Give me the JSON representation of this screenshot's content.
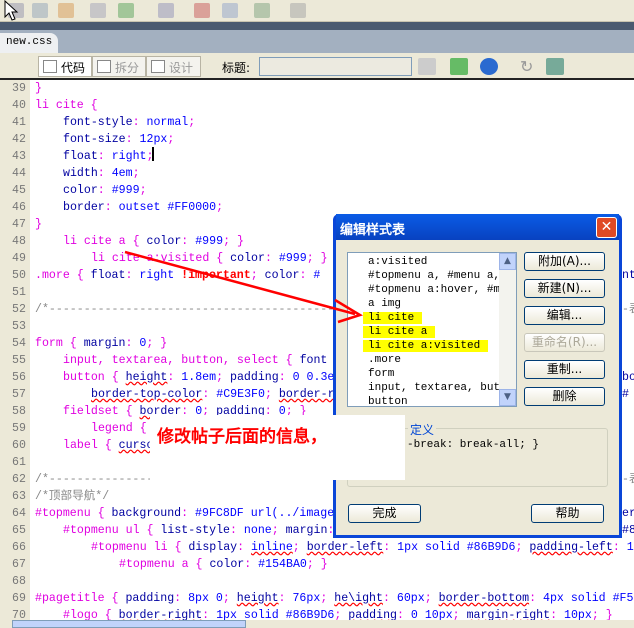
{
  "file_tab": "new.css",
  "view_buttons": {
    "code": "代码",
    "split": "拆分",
    "design": "设计"
  },
  "title_label": "标题:",
  "title_value": "",
  "code_lines": [
    {
      "n": "39",
      "ind": 0,
      "segs": [
        [
          "s",
          "}"
        ]
      ]
    },
    {
      "n": "40",
      "ind": 0,
      "segs": [
        [
          "s",
          "li cite {"
        ]
      ]
    },
    {
      "n": "41",
      "ind": 4,
      "segs": [
        [
          "p",
          "font-style"
        ],
        [
          "b",
          ": "
        ],
        [
          "v",
          "normal"
        ],
        [
          "b",
          ";"
        ]
      ]
    },
    {
      "n": "42",
      "ind": 4,
      "segs": [
        [
          "p",
          "font-size"
        ],
        [
          "b",
          ": "
        ],
        [
          "v",
          "12px"
        ],
        [
          "b",
          ";"
        ]
      ]
    },
    {
      "n": "43",
      "ind": 4,
      "segs": [
        [
          "p",
          "float"
        ],
        [
          "b",
          ": "
        ],
        [
          "v",
          "right"
        ],
        [
          "b",
          ";"
        ]
      ]
    },
    {
      "n": "44",
      "ind": 4,
      "segs": [
        [
          "p",
          "width"
        ],
        [
          "b",
          ": "
        ],
        [
          "v",
          "4em"
        ],
        [
          "b",
          ";"
        ]
      ]
    },
    {
      "n": "45",
      "ind": 4,
      "segs": [
        [
          "p",
          "color"
        ],
        [
          "b",
          ": "
        ],
        [
          "v",
          "#999"
        ],
        [
          "b",
          ";"
        ]
      ]
    },
    {
      "n": "46",
      "ind": 4,
      "segs": [
        [
          "p",
          "border"
        ],
        [
          "b",
          ": "
        ],
        [
          "v",
          "outset #FF0000"
        ],
        [
          "b",
          ";"
        ]
      ]
    },
    {
      "n": "47",
      "ind": 0,
      "segs": [
        [
          "s",
          "}"
        ]
      ]
    },
    {
      "n": "48",
      "ind": 4,
      "segs": [
        [
          "s",
          "li cite a { "
        ],
        [
          "p",
          "color"
        ],
        [
          "b",
          ": "
        ],
        [
          "v",
          "#999"
        ],
        [
          "b",
          "; }"
        ]
      ]
    },
    {
      "n": "49",
      "ind": 8,
      "segs": [
        [
          "s",
          "li cite a:visited { "
        ],
        [
          "p",
          "color"
        ],
        [
          "b",
          ": "
        ],
        [
          "v",
          "#999"
        ],
        [
          "b",
          "; }"
        ]
      ]
    },
    {
      "n": "50",
      "ind": 0,
      "segs": [
        [
          "s",
          ".more { "
        ],
        [
          "p",
          "float"
        ],
        [
          "b",
          ": "
        ],
        [
          "v",
          "right "
        ],
        [
          "i",
          "!important"
        ],
        [
          "b",
          "; "
        ],
        [
          "p",
          "color"
        ],
        [
          "b",
          ": "
        ],
        [
          "v",
          "#"
        ]
      ],
      "right": "nt"
    },
    {
      "n": "51",
      "ind": 0,
      "segs": []
    },
    {
      "n": "52",
      "ind": 0,
      "segs": [
        [
          "c",
          "/*----------------------------------------------------------------------------"
        ]
      ],
      "right": "-表"
    },
    {
      "n": "53",
      "ind": 0,
      "segs": []
    },
    {
      "n": "54",
      "ind": 0,
      "segs": [
        [
          "s",
          "form { "
        ],
        [
          "p",
          "margin"
        ],
        [
          "b",
          ": "
        ],
        [
          "v",
          "0"
        ],
        [
          "b",
          "; }"
        ]
      ]
    },
    {
      "n": "55",
      "ind": 4,
      "segs": [
        [
          "s",
          "input, textarea, button, select { "
        ],
        [
          "p",
          "font"
        ]
      ]
    },
    {
      "n": "56",
      "ind": 4,
      "segs": [
        [
          "s",
          "button { "
        ],
        [
          "pe",
          "height"
        ],
        [
          "b",
          ": "
        ],
        [
          "v",
          "1.8em"
        ],
        [
          "b",
          "; "
        ],
        [
          "p",
          "padding"
        ],
        [
          "b",
          ": "
        ],
        [
          "v",
          "0 0.3em"
        ]
      ],
      "right": "bo"
    },
    {
      "n": "57",
      "ind": 8,
      "segs": [
        [
          "pe",
          "border-top-color"
        ],
        [
          "b",
          ": "
        ],
        [
          "v",
          "#C9E3F0"
        ],
        [
          "b",
          "; "
        ],
        [
          "pe",
          "border-r"
        ]
      ],
      "right": "#"
    },
    {
      "n": "58",
      "ind": 4,
      "segs": [
        [
          "s",
          "fieldset { "
        ],
        [
          "pe",
          "border"
        ],
        [
          "b",
          ": "
        ],
        [
          "v",
          "0"
        ],
        [
          "b",
          "; "
        ],
        [
          "p",
          "padding"
        ],
        [
          "b",
          ": "
        ],
        [
          "v",
          "0"
        ],
        [
          "b",
          "; }"
        ]
      ]
    },
    {
      "n": "59",
      "ind": 8,
      "segs": [
        [
          "s",
          "legend { "
        ]
      ]
    },
    {
      "n": "60",
      "ind": 4,
      "segs": [
        [
          "s",
          "label { "
        ],
        [
          "pe",
          "curso"
        ]
      ]
    },
    {
      "n": "61",
      "ind": 0,
      "segs": []
    },
    {
      "n": "62",
      "ind": 0,
      "segs": [
        [
          "c",
          "/*---------------"
        ]
      ],
      "right": "-表"
    },
    {
      "n": "63",
      "ind": 0,
      "segs": [
        [
          "c",
          "/*顶部导航*/"
        ]
      ]
    },
    {
      "n": "64",
      "ind": 0,
      "segs": [
        [
          "s",
          "#topmenu { "
        ],
        [
          "p",
          "background"
        ],
        [
          "b",
          ": "
        ],
        [
          "v",
          "#9FC8DF url(../image"
        ]
      ],
      "right": "er"
    },
    {
      "n": "65",
      "ind": 4,
      "segs": [
        [
          "s",
          "#topmenu ul { "
        ],
        [
          "p",
          "list-style"
        ],
        [
          "b",
          ": "
        ],
        [
          "v",
          "none"
        ],
        [
          "b",
          "; "
        ],
        [
          "p",
          "margin"
        ],
        [
          "b",
          ":"
        ]
      ],
      "right": "#8"
    },
    {
      "n": "66",
      "ind": 8,
      "segs": [
        [
          "s",
          "#topmenu li { "
        ],
        [
          "p",
          "display"
        ],
        [
          "b",
          ": "
        ],
        [
          "ve",
          "inline"
        ],
        [
          "b",
          "; "
        ],
        [
          "pe",
          "border-left"
        ],
        [
          "b",
          ": "
        ],
        [
          "v",
          "1px solid #86B9D6"
        ],
        [
          "b",
          "; "
        ],
        [
          "pe",
          "padding-left"
        ],
        [
          "b",
          ": "
        ],
        [
          "v",
          "1"
        ]
      ]
    },
    {
      "n": "67",
      "ind": 12,
      "segs": [
        [
          "s",
          "#topmenu a { "
        ],
        [
          "p",
          "color"
        ],
        [
          "b",
          ": "
        ],
        [
          "v",
          "#154BA0"
        ],
        [
          "b",
          "; }"
        ]
      ]
    },
    {
      "n": "68",
      "ind": 0,
      "segs": []
    },
    {
      "n": "69",
      "ind": 0,
      "segs": [
        [
          "s",
          "#pagetitle { "
        ],
        [
          "p",
          "padding"
        ],
        [
          "b",
          ": "
        ],
        [
          "v",
          "8px 0"
        ],
        [
          "b",
          "; "
        ],
        [
          "pe",
          "height"
        ],
        [
          "b",
          ": "
        ],
        [
          "v",
          "76px"
        ],
        [
          "b",
          "; "
        ],
        [
          "pe",
          "he\\ight"
        ],
        [
          "b",
          ": "
        ],
        [
          "v",
          "60px"
        ],
        [
          "b",
          "; "
        ],
        [
          "pe",
          "border-bottom"
        ],
        [
          "b",
          ": "
        ],
        [
          "v",
          "4px solid #F5"
        ]
      ]
    },
    {
      "n": "70",
      "ind": 4,
      "segs": [
        [
          "s",
          "#logo { "
        ],
        [
          "pe",
          "border-right"
        ],
        [
          "b",
          ": "
        ],
        [
          "v",
          "1px solid #86B9D6"
        ],
        [
          "b",
          "; "
        ],
        [
          "pe",
          "padding"
        ],
        [
          "b",
          ": "
        ],
        [
          "v",
          "0 10px"
        ],
        [
          "b",
          "; "
        ],
        [
          "pe",
          "margin-right"
        ],
        [
          "b",
          ": "
        ],
        [
          "v",
          "10px"
        ],
        [
          "b",
          "; }"
        ]
      ]
    }
  ],
  "dialog": {
    "title": "编辑样式表",
    "rules": [
      "a:visited",
      "#topmenu a, #menu a, .",
      "#topmenu a:hover, #men",
      "a img",
      "li cite",
      "li cite a",
      "li cite a:visited",
      ".more",
      "form",
      "input, textarea, butto",
      "button"
    ],
    "highlighted": [
      "li cite",
      "li cite a",
      "li cite a:visited"
    ],
    "buttons": {
      "attach": "附加(A)...",
      "new": "新建(N)...",
      "edit": "编辑...",
      "rename": "重命名(R)...",
      "duplicate": "重制...",
      "delete": "删除"
    },
    "group_label": "定义",
    "group_text": "-break: break-all; }",
    "done": "完成",
    "help": "帮助"
  },
  "annotation": "修改帖子后面的信息，",
  "colors": {
    "selector": "#e000e0",
    "property": "#0000a0",
    "value": "#0000ff",
    "annotation": "#ff0000",
    "highlight": "#ffff00",
    "titlebar": "#0a5ce6"
  }
}
